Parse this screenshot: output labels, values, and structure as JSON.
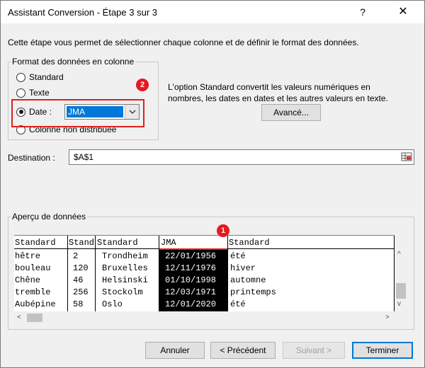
{
  "window": {
    "title": "Assistant Conversion - Étape 3 sur 3",
    "help": "?",
    "close": "✕"
  },
  "intro": "Cette étape vous permet de sélectionner chaque colonne et de définir le format des données.",
  "format_group": {
    "legend": "Format des données en colonne",
    "options": [
      {
        "label": "Standard",
        "checked": false
      },
      {
        "label": "Texte",
        "checked": false
      },
      {
        "label": "Date :",
        "checked": true
      },
      {
        "label": "Colonne non distribuée",
        "checked": false
      }
    ],
    "date_format": "JMA"
  },
  "annotations": {
    "badge_1": "1",
    "badge_2": "2",
    "color": "#e8181e"
  },
  "explanation_line1": "L'option Standard convertit les valeurs numériques en",
  "explanation_line2": "nombres, les dates en dates et les autres valeurs en texte.",
  "advanced_button": "Avancé...",
  "destination": {
    "label": "Destination :",
    "value": "$A$1"
  },
  "preview": {
    "legend": "Aperçu de données",
    "headers": [
      "Standard",
      "Stand",
      "Standard",
      "JMA",
      "Standard"
    ],
    "rows": [
      [
        "hêtre",
        "2",
        "Trondheim",
        "22/01/1956",
        "été"
      ],
      [
        "bouleau",
        "120",
        "Bruxelles",
        "12/11/1976",
        "hiver"
      ],
      [
        "Chêne",
        "46",
        "Helsinski",
        "01/10/1998",
        "automne"
      ],
      [
        "tremble",
        "256",
        "Stockolm",
        "12/03/1971",
        "printemps"
      ],
      [
        "Aubépine",
        "58",
        "Oslo",
        "12/01/2020",
        "été"
      ]
    ]
  },
  "buttons": {
    "cancel": "Annuler",
    "previous": "< Précédent",
    "next": "Suivant >",
    "finish": "Terminer"
  },
  "colors": {
    "selection": "#0078d7",
    "highlight_border": "#e02020"
  }
}
